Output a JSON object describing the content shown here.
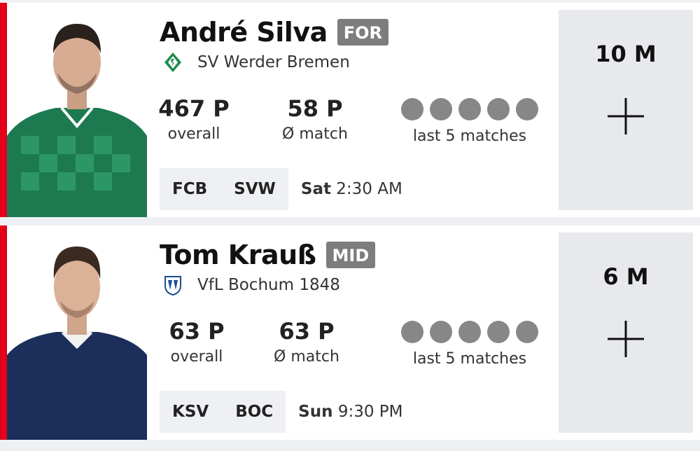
{
  "players": [
    {
      "name": "André Silva",
      "position": "FOR",
      "club": "SV Werder Bremen",
      "club_icon": "werder-bremen-crest-icon",
      "overall_points": "467 P",
      "overall_label": "overall",
      "avg_points": "58 P",
      "avg_label": "Ø match",
      "form_label": "last 5 matches",
      "form_results": [
        "none",
        "none",
        "none",
        "none",
        "none"
      ],
      "fixture": {
        "home": "FCB",
        "away": "SVW",
        "day": "Sat",
        "time": "2:30 AM"
      },
      "price": "10 M",
      "add_icon": "plus-icon",
      "jersey_color": "#1d7a50"
    },
    {
      "name": "Tom Krauß",
      "position": "MID",
      "club": "VfL Bochum 1848",
      "club_icon": "bochum-crest-icon",
      "overall_points": "63 P",
      "overall_label": "overall",
      "avg_points": "63 P",
      "avg_label": "Ø match",
      "form_label": "last 5 matches",
      "form_results": [
        "none",
        "none",
        "none",
        "none",
        "none"
      ],
      "fixture": {
        "home": "KSV",
        "away": "BOC",
        "day": "Sun",
        "time": "9:30 PM"
      },
      "price": "6 M",
      "add_icon": "plus-icon",
      "jersey_color": "#1c2e5a"
    }
  ],
  "colors": {
    "accent": "#e2001a",
    "badge": "#7d7d7d",
    "form_dot": "#878787",
    "price_panel": "#e8e9ec"
  }
}
